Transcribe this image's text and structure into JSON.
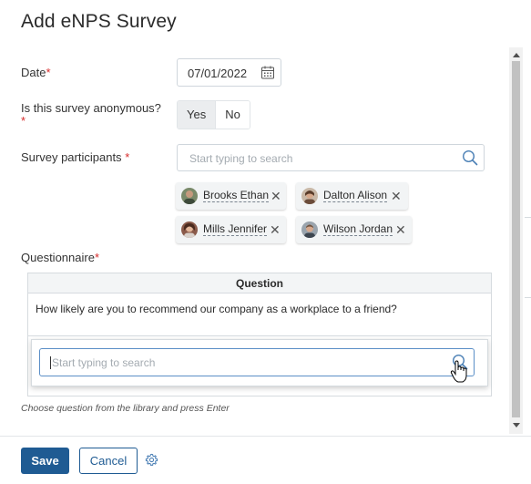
{
  "dialog": {
    "title": "Add eNPS Survey"
  },
  "fields": {
    "date": {
      "label": "Date",
      "required": "*",
      "value": "07/01/2022"
    },
    "anonymous": {
      "label": "Is this survey anonymous?",
      "required": "*",
      "options": [
        "Yes",
        "No"
      ],
      "selected": "Yes"
    },
    "participants": {
      "label": "Survey participants",
      "required": "*",
      "placeholder": "Start typing to search",
      "selected": [
        {
          "name": "Brooks Ethan"
        },
        {
          "name": "Dalton Alison"
        },
        {
          "name": "Mills Jennifer"
        },
        {
          "name": "Wilson Jordan"
        }
      ]
    },
    "questionnaire": {
      "label": "Questionnaire",
      "required": "*",
      "column_header": "Question",
      "rows": [
        "How likely are you to recommend our company as a workplace to a friend?"
      ],
      "search_placeholder": "Start typing to search",
      "hint": "Choose question from the library and press Enter"
    }
  },
  "footer": {
    "save_label": "Save",
    "cancel_label": "Cancel"
  },
  "icons": {
    "calendar": "calendar-icon",
    "search": "search-icon",
    "remove": "close-icon",
    "settings": "gear-icon"
  },
  "colors": {
    "primary": "#1f5b93",
    "required": "#d62b2b",
    "focus_border": "#5b8fc7"
  }
}
